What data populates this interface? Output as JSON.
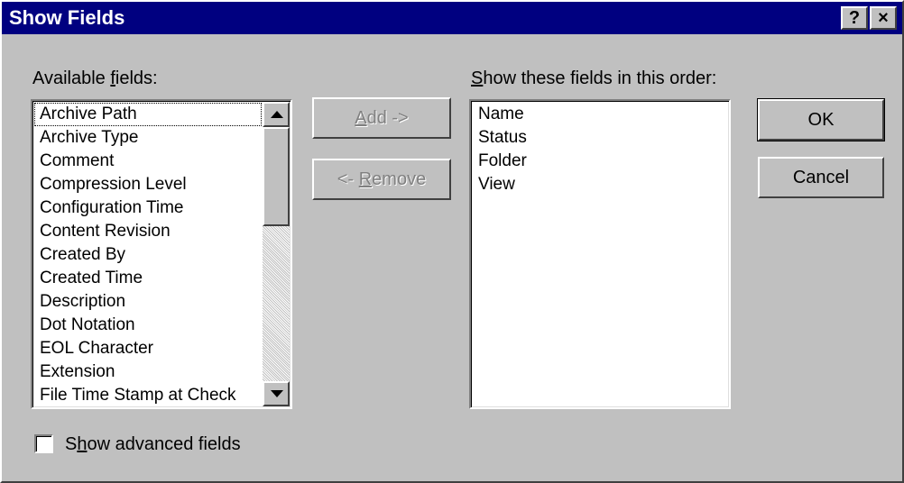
{
  "window": {
    "title": "Show Fields",
    "help_button": "?",
    "close_button": "×"
  },
  "available": {
    "label_mnemonic_prefix": "Available ",
    "label_mnemonic": "f",
    "label_mnemonic_suffix": "ields:",
    "items": [
      "Archive Path",
      "Archive Type",
      "Comment",
      "Compression Level",
      "Configuration Time",
      "Content Revision",
      "Created By",
      "Created Time",
      "Description",
      "Dot Notation",
      "EOL Character",
      "Extension",
      "File Time Stamp at Check"
    ]
  },
  "buttons": {
    "add_prefix": "",
    "add_mnemonic": "A",
    "add_suffix": "dd ->",
    "remove_prefix": "<- ",
    "remove_mnemonic": "R",
    "remove_suffix": "emove",
    "ok": "OK",
    "cancel": "Cancel"
  },
  "shown": {
    "label_mnemonic": "S",
    "label_suffix": "how these fields in this order:",
    "items": [
      "Name",
      "Status",
      "Folder",
      "View"
    ]
  },
  "advanced": {
    "label_prefix": "S",
    "label_mnemonic": "h",
    "label_suffix": "ow advanced fields",
    "checked": false
  },
  "colors": {
    "titlebar": "#000080",
    "face": "#c0c0c0"
  }
}
